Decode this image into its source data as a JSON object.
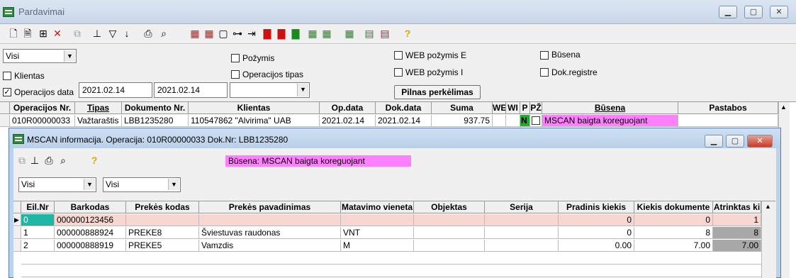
{
  "window": {
    "title": "Pardavimai"
  },
  "icons": {
    "toolbar": [
      "new-doc-icon",
      "doc-icon",
      "tree-icon",
      "delete-icon",
      "copy-icon",
      "hierarchy-icon",
      "filter-icon",
      "sort-icon",
      "print-icon",
      "find-icon",
      "add-icon",
      "add-icon",
      "page-icon",
      "link-icon",
      "move-icon",
      "export-icon",
      "export-icon",
      "export-icon",
      "export-icon",
      "export-icon",
      "export-icon",
      "export-icon",
      "help-icon"
    ]
  },
  "filters": {
    "combo1": "Visi",
    "pozymis": "Požymis",
    "web_e": "WEB požymis E",
    "busena": "Būsena",
    "klientas": "Klientas",
    "operacijos_tipas": "Operacijos tipas",
    "web_i": "WEB požymis I",
    "dok_registre": "Dok.registre",
    "operacijos_data": "Operacijos data",
    "operacijos_data_checked": "✓",
    "date_from": "2021.02.14",
    "date_to": "2021.02.14",
    "combo2": "",
    "button": "Pilnas perkėlimas"
  },
  "grid": {
    "headers": [
      "Operacijos Nr.",
      "Tipas",
      "Dokumento Nr.",
      "Klientas",
      "Op.data",
      "Dok.data",
      "Suma",
      "WE",
      "WI",
      "P",
      "PŽ",
      "Būsena",
      "Pastabos"
    ],
    "row": {
      "op_nr": "010R00000033",
      "tipas": "Važtaraštis",
      "dok_nr": "LBB1235280",
      "klientas": "110547862  \"Alvirima\" UAB",
      "op_data": "2021.02.14",
      "dok_data": "2021.02.14",
      "suma": "937.75",
      "we": "",
      "wi": "",
      "p": "N",
      "pz": "",
      "busena": "MSCAN baigta koreguojant",
      "pastabos": ""
    }
  },
  "child": {
    "title": "MSCAN informacija. Operacija: 010R00000033 Dok.Nr: LBB1235280",
    "status": "Būsena: MSCAN baigta koreguojant",
    "combo1": "Visi",
    "combo2": "Visi",
    "headers": [
      "Eil.Nr",
      "Barkodas",
      "Prekės kodas",
      "Prekės pavadinimas",
      "Matavimo vieneta",
      "Objektas",
      "Serija",
      "Pradinis kiekis",
      "Kiekis dokumente",
      "Atrinktas ki"
    ],
    "rows": [
      {
        "eil": "0",
        "bar": "000000123456",
        "kodas": "",
        "pav": "",
        "mat": "",
        "obj": "",
        "ser": "",
        "prad": "0",
        "kiek": "0",
        "atr": "1"
      },
      {
        "eil": "1",
        "bar": "000000888924",
        "kodas": "PREKE8",
        "pav": "Šviestuvas raudonas",
        "mat": "VNT",
        "obj": "",
        "ser": "",
        "prad": "0",
        "kiek": "8",
        "atr": "8"
      },
      {
        "eil": "2",
        "bar": "000000888919",
        "kodas": "PREKE5",
        "pav": "Vamzdis",
        "mat": "M",
        "obj": "",
        "ser": "",
        "prad": "0.00",
        "kiek": "7.00",
        "atr": "7.00"
      }
    ]
  },
  "colors": {
    "status_pink": "#ff80ff",
    "row_pink": "#f8d7d2",
    "p_green": "#22aa33",
    "selected_cell": "#1fb6a8"
  }
}
